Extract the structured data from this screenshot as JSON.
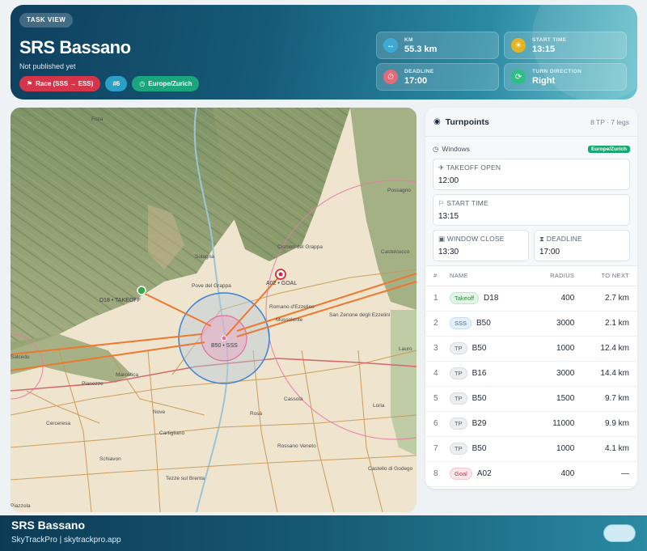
{
  "header": {
    "tag": "TASK VIEW",
    "title": "SRS Bassano",
    "subtitle": "Not published yet",
    "chips": [
      "Race (SSS → ESS)",
      "#6",
      "Europe/Zurich"
    ]
  },
  "stats": [
    {
      "label": "KM",
      "value": "55.3 km",
      "icon": "arrows-horizontal-icon",
      "color": "#3fa9d6"
    },
    {
      "label": "START TIME",
      "value": "13:15",
      "icon": "sun-icon",
      "color": "#e6b422"
    },
    {
      "label": "DEADLINE",
      "value": "17:00",
      "icon": "stopwatch-icon",
      "color": "#e06b7a"
    },
    {
      "label": "TURN DIRECTION",
      "value": "Right",
      "icon": "refresh-icon",
      "color": "#2fbf85"
    }
  ],
  "map": {
    "labels": {
      "takeoff": "D18 • TAKEOFF",
      "sss": "B50 • SSS",
      "goal": "A02 • GOAL"
    },
    "places": [
      "Foza",
      "Possagno",
      "Castelcucco",
      "Cismon del Grappa",
      "Solagna",
      "Pove del Grappa",
      "Romano d'Ezzelino",
      "San Zenone degli Ezzelini",
      "Mussolente",
      "Marostica",
      "Pianezze",
      "Salcedo",
      "Nove",
      "Cartigliano",
      "Cassola",
      "Rosà",
      "Schiavon",
      "Rossano Veneto",
      "Castello di Godego",
      "Tezze sul Brenta",
      "Cerceresa",
      "Lauro",
      "Loria",
      "Piazzola"
    ]
  },
  "panel": {
    "title": "Turnpoints",
    "meta": "8 TP · 7 legs",
    "windows": {
      "title": "Windows",
      "tz": "Europe/Zurich",
      "takeoff_label": "TAKEOFF OPEN",
      "takeoff_value": "12:00",
      "start_label": "START TIME",
      "start_value": "13:15",
      "close_label": "WINDOW CLOSE",
      "close_value": "13:30",
      "deadline_label": "DEADLINE",
      "deadline_value": "17:00"
    },
    "columns": [
      "#",
      "NAME",
      "RADIUS",
      "TO NEXT"
    ],
    "rows": [
      {
        "n": "1",
        "type": "Takeoff",
        "name": "D18",
        "radius": "400",
        "next": "2.7 km"
      },
      {
        "n": "2",
        "type": "SSS",
        "name": "B50",
        "radius": "3000",
        "next": "2.1 km"
      },
      {
        "n": "3",
        "type": "TP",
        "name": "B50",
        "radius": "1000",
        "next": "12.4 km"
      },
      {
        "n": "4",
        "type": "TP",
        "name": "B16",
        "radius": "3000",
        "next": "14.4 km"
      },
      {
        "n": "5",
        "type": "TP",
        "name": "B50",
        "radius": "1500",
        "next": "9.7 km"
      },
      {
        "n": "6",
        "type": "TP",
        "name": "B29",
        "radius": "11000",
        "next": "9.9 km"
      },
      {
        "n": "7",
        "type": "TP",
        "name": "B50",
        "radius": "1000",
        "next": "4.1 km"
      },
      {
        "n": "8",
        "type": "Goal",
        "name": "A02",
        "radius": "400",
        "next": "—"
      }
    ]
  },
  "footer": {
    "title": "SRS Bassano",
    "subtitle": "SkyTrackPro | skytrackpro.app"
  }
}
